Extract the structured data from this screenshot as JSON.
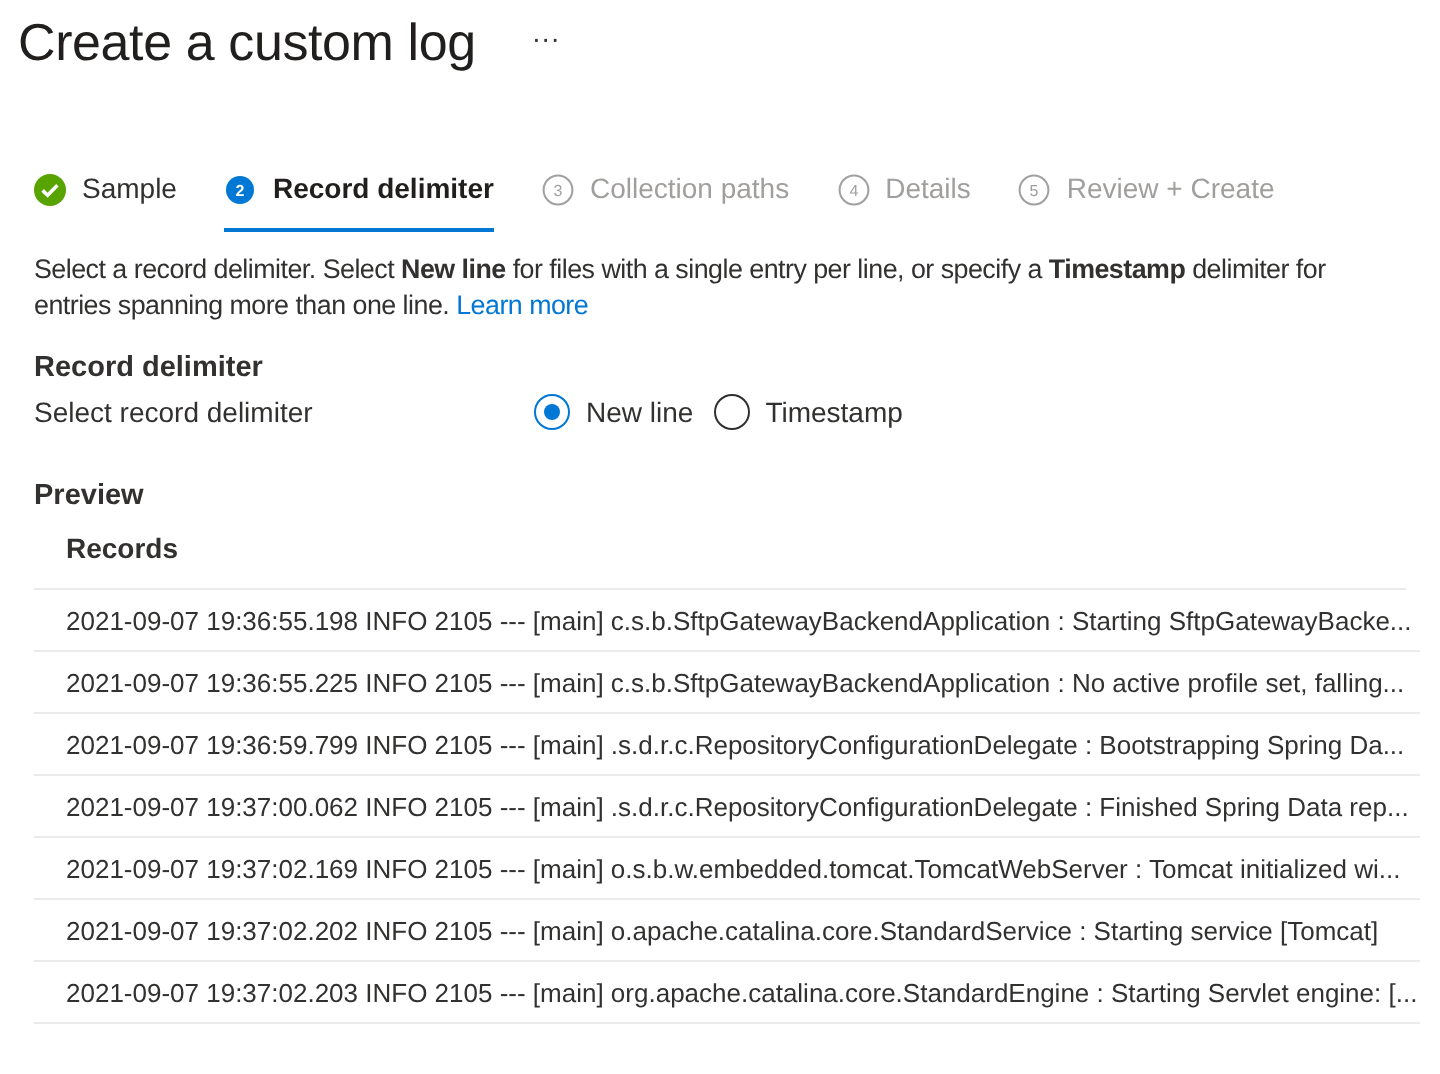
{
  "header": {
    "title": "Create a custom log",
    "more": "···"
  },
  "steps": [
    {
      "label": "Sample",
      "kind": "done",
      "selected": false
    },
    {
      "label": "Record delimiter",
      "number": "2",
      "kind": "current",
      "selected": true
    },
    {
      "label": "Collection paths",
      "number": "3",
      "kind": "pending",
      "selected": false
    },
    {
      "label": "Details",
      "number": "4",
      "kind": "pending",
      "selected": false
    },
    {
      "label": "Review + Create",
      "number": "5",
      "kind": "pending",
      "selected": false
    }
  ],
  "description": {
    "text": "Select a record delimiter. Select **New line** for files with a single entry per line, or specify a **Timestamp** delimiter for entries spanning more than one line.",
    "link": "Learn more"
  },
  "record_delimiter": {
    "heading": "Record delimiter",
    "label": "Select record delimiter",
    "options": [
      {
        "label": "New line",
        "selected": true
      },
      {
        "label": "Timestamp",
        "selected": false
      }
    ]
  },
  "preview": {
    "heading": "Preview",
    "column": "Records",
    "rows": [
      "2021-09-07 19:36:55.198 INFO 2105 --- [main] c.s.b.SftpGatewayBackendApplication : Starting SftpGatewayBacke...",
      "2021-09-07 19:36:55.225 INFO 2105 --- [main] c.s.b.SftpGatewayBackendApplication : No active profile set, falling...",
      "2021-09-07 19:36:59.799 INFO 2105 --- [main] .s.d.r.c.RepositoryConfigurationDelegate : Bootstrapping Spring Da...",
      "2021-09-07 19:37:00.062 INFO 2105 --- [main] .s.d.r.c.RepositoryConfigurationDelegate : Finished Spring Data rep...",
      "2021-09-07 19:37:02.169 INFO 2105 --- [main] o.s.b.w.embedded.tomcat.TomcatWebServer : Tomcat initialized wi...",
      "2021-09-07 19:37:02.202 INFO 2105 --- [main] o.apache.catalina.core.StandardService : Starting service [Tomcat]",
      "2021-09-07 19:37:02.203 INFO 2105 --- [main] org.apache.catalina.core.StandardEngine : Starting Servlet engine: [..."
    ]
  }
}
